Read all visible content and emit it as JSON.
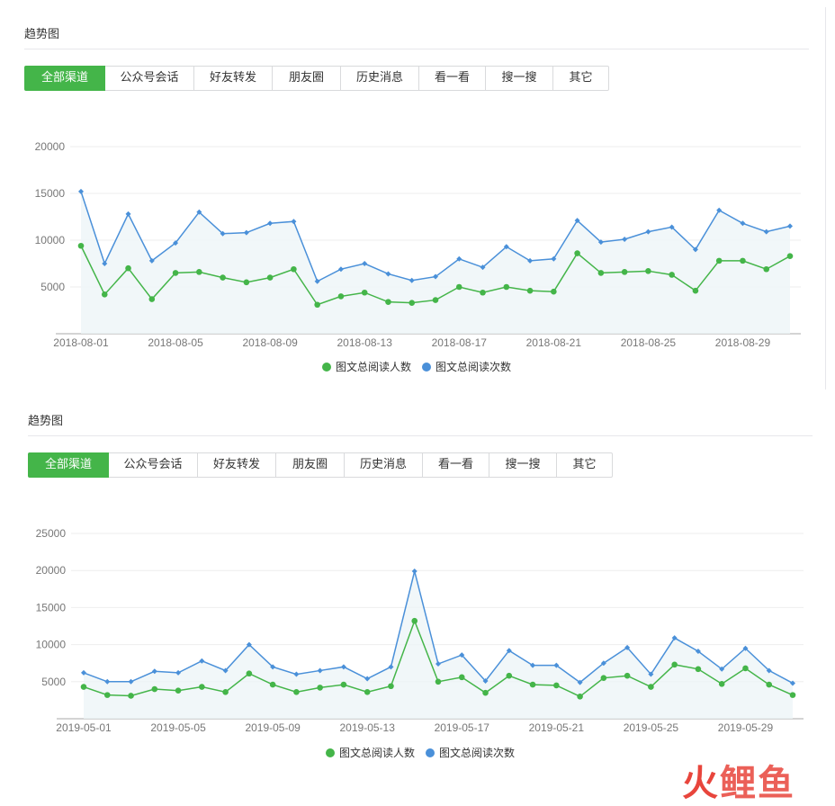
{
  "panels": [
    {
      "title": "趋势图",
      "tabs": [
        "全部渠道",
        "公众号会话",
        "好友转发",
        "朋友圈",
        "历史消息",
        "看一看",
        "搜一搜",
        "其它"
      ],
      "active_tab": 0,
      "legend": [
        "图文总阅读人数",
        "图文总阅读次数"
      ]
    },
    {
      "title": "趋势图",
      "tabs": [
        "全部渠道",
        "公众号会话",
        "好友转发",
        "朋友圈",
        "历史消息",
        "看一看",
        "搜一搜",
        "其它"
      ],
      "active_tab": 0,
      "legend": [
        "图文总阅读人数",
        "图文总阅读次数"
      ]
    }
  ],
  "colors": {
    "green": "#44b549",
    "blue": "#4a90d9",
    "active_tab": "#44b549"
  },
  "watermark": [
    "火",
    "鲤鱼"
  ],
  "chart_data": [
    {
      "type": "line",
      "x": [
        "2018-08-01",
        "2018-08-02",
        "2018-08-03",
        "2018-08-04",
        "2018-08-05",
        "2018-08-06",
        "2018-08-07",
        "2018-08-08",
        "2018-08-09",
        "2018-08-10",
        "2018-08-11",
        "2018-08-12",
        "2018-08-13",
        "2018-08-14",
        "2018-08-15",
        "2018-08-16",
        "2018-08-17",
        "2018-08-18",
        "2018-08-19",
        "2018-08-20",
        "2018-08-21",
        "2018-08-22",
        "2018-08-23",
        "2018-08-24",
        "2018-08-25",
        "2018-08-26",
        "2018-08-27",
        "2018-08-28",
        "2018-08-29",
        "2018-08-30",
        "2018-08-31"
      ],
      "x_tick_labels": [
        "2018-08-01",
        "2018-08-05",
        "2018-08-09",
        "2018-08-13",
        "2018-08-17",
        "2018-08-21",
        "2018-08-25",
        "2018-08-29"
      ],
      "y_ticks": [
        5000,
        10000,
        15000,
        20000
      ],
      "ylim": [
        0,
        20000
      ],
      "series": [
        {
          "name": "图文总阅读人数",
          "color": "#44b549",
          "values": [
            9400,
            4200,
            7000,
            3700,
            6500,
            6600,
            6000,
            5500,
            6000,
            6900,
            3100,
            4000,
            4400,
            3400,
            3300,
            3600,
            5000,
            4400,
            5000,
            4600,
            4500,
            8600,
            6500,
            6600,
            6700,
            6300,
            4600,
            7800,
            7800,
            6900,
            8300
          ]
        },
        {
          "name": "图文总阅读次数",
          "color": "#4a90d9",
          "values": [
            15200,
            7500,
            12800,
            7800,
            9700,
            13000,
            10700,
            10800,
            11800,
            12000,
            5600,
            6900,
            7500,
            6400,
            5700,
            6100,
            8000,
            7100,
            9300,
            7800,
            8000,
            12100,
            9800,
            10100,
            10900,
            11400,
            9000,
            13200,
            11800,
            10900,
            11500
          ]
        }
      ],
      "legend_position": "bottom-center",
      "grid": true
    },
    {
      "type": "line",
      "x": [
        "2019-05-01",
        "2019-05-02",
        "2019-05-03",
        "2019-05-04",
        "2019-05-05",
        "2019-05-06",
        "2019-05-07",
        "2019-05-08",
        "2019-05-09",
        "2019-05-10",
        "2019-05-11",
        "2019-05-12",
        "2019-05-13",
        "2019-05-14",
        "2019-05-15",
        "2019-05-16",
        "2019-05-17",
        "2019-05-18",
        "2019-05-19",
        "2019-05-20",
        "2019-05-21",
        "2019-05-22",
        "2019-05-23",
        "2019-05-24",
        "2019-05-25",
        "2019-05-26",
        "2019-05-27",
        "2019-05-28",
        "2019-05-29",
        "2019-05-30",
        "2019-05-31"
      ],
      "x_tick_labels": [
        "2019-05-01",
        "2019-05-05",
        "2019-05-09",
        "2019-05-13",
        "2019-05-17",
        "2019-05-21",
        "2019-05-25",
        "2019-05-29"
      ],
      "y_ticks": [
        5000,
        10000,
        15000,
        20000,
        25000
      ],
      "ylim": [
        0,
        25000
      ],
      "series": [
        {
          "name": "图文总阅读人数",
          "color": "#44b549",
          "values": [
            4300,
            3200,
            3100,
            4000,
            3800,
            4300,
            3600,
            6100,
            4600,
            3600,
            4200,
            4600,
            3600,
            4400,
            13200,
            5000,
            5600,
            3500,
            5800,
            4600,
            4500,
            3000,
            5500,
            5800,
            4300,
            7300,
            6700,
            4700,
            6800,
            4600,
            3200
          ]
        },
        {
          "name": "图文总阅读次数",
          "color": "#4a90d9",
          "values": [
            6200,
            5000,
            5000,
            6400,
            6200,
            7800,
            6500,
            10000,
            7000,
            6000,
            6500,
            7000,
            5400,
            7000,
            19900,
            7400,
            8600,
            5100,
            9200,
            7200,
            7200,
            4900,
            7500,
            9600,
            6000,
            10900,
            9100,
            6700,
            9500,
            6500,
            4800
          ]
        }
      ],
      "legend_position": "bottom-center",
      "grid": true
    }
  ]
}
